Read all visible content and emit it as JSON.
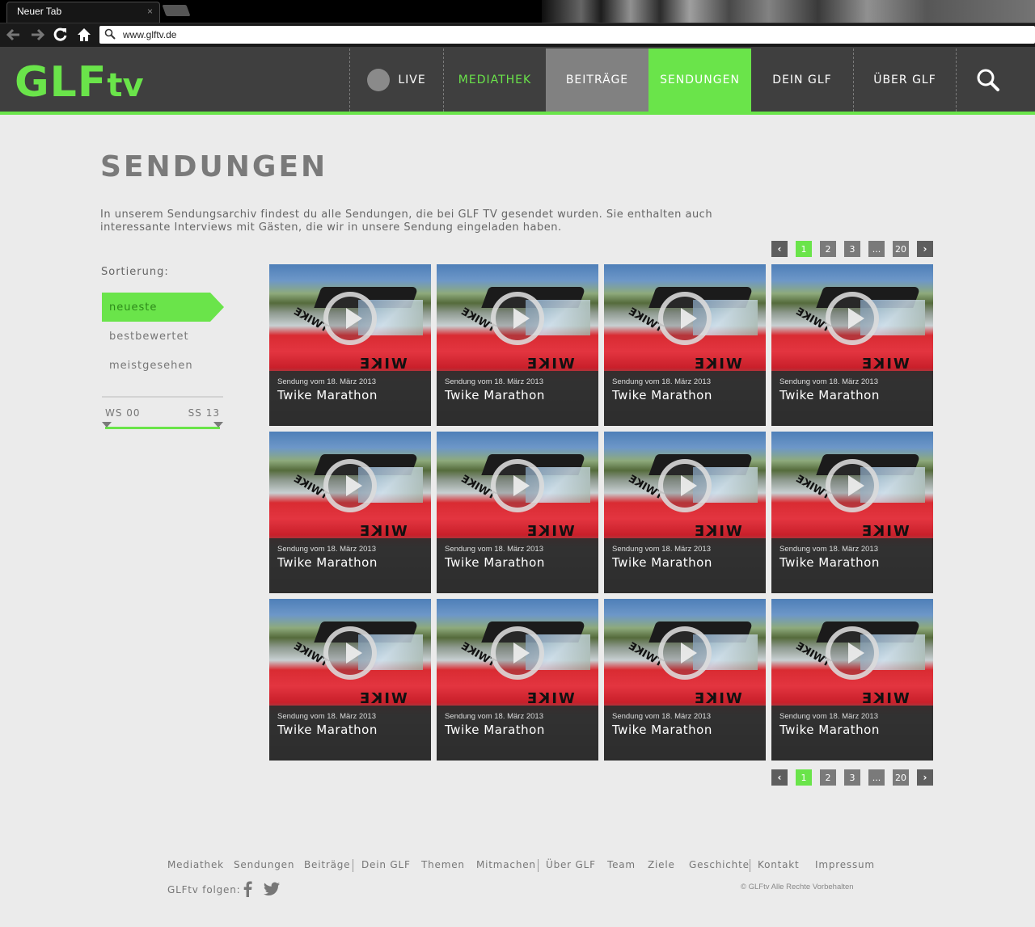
{
  "browser": {
    "tab_title": "Neuer Tab",
    "tab_close": "×",
    "url": "www.glftv.de"
  },
  "header": {
    "logo_main": "GLF",
    "logo_suffix": "tv",
    "nav": [
      {
        "label": "LIVE"
      },
      {
        "label": "MEDIATHEK"
      },
      {
        "label": "BEITRÄGE"
      },
      {
        "label": "SENDUNGEN"
      },
      {
        "label": "DEIN GLF"
      },
      {
        "label": "ÜBER GLF"
      }
    ]
  },
  "page": {
    "title": "SENDUNGEN",
    "intro": "In unserem Sendungsarchiv findest du alle Sendungen, die bei GLF TV gesendet wurden. Sie enthalten auch interessante Interviews mit Gästen, die wir in unsere Sendung eingeladen haben."
  },
  "pagination": {
    "prev": "‹",
    "next": "›",
    "pages": [
      "1",
      "2",
      "3",
      "...",
      "20"
    ],
    "current": "1"
  },
  "sidebar": {
    "sort_label": "Sortierung:",
    "sort_options": [
      "neueste",
      "bestbewertet",
      "meistgesehen"
    ],
    "active_sort": "neueste",
    "range_start": "WS 00",
    "range_end": "SS 13"
  },
  "cards": [
    {
      "date": "Sendung vom 18. März 2013",
      "title": "Twike Marathon"
    },
    {
      "date": "Sendung vom 18. März 2013",
      "title": "Twike Marathon"
    },
    {
      "date": "Sendung vom 18. März 2013",
      "title": "Twike Marathon"
    },
    {
      "date": "Sendung vom 18. März 2013",
      "title": "Twike Marathon"
    },
    {
      "date": "Sendung vom 18. März 2013",
      "title": "Twike Marathon"
    },
    {
      "date": "Sendung vom 18. März 2013",
      "title": "Twike Marathon"
    },
    {
      "date": "Sendung vom 18. März 2013",
      "title": "Twike Marathon"
    },
    {
      "date": "Sendung vom 18. März 2013",
      "title": "Twike Marathon"
    },
    {
      "date": "Sendung vom 18. März 2013",
      "title": "Twike Marathon"
    },
    {
      "date": "Sendung vom 18. März 2013",
      "title": "Twike Marathon"
    },
    {
      "date": "Sendung vom 18. März 2013",
      "title": "Twike Marathon"
    },
    {
      "date": "Sendung vom 18. März 2013",
      "title": "Twike Marathon"
    }
  ],
  "card_image_text": {
    "brand": "WIKE",
    "brand_side": "TWIKE"
  },
  "footer": {
    "links": [
      "Mediathek",
      "Sendungen",
      "Beiträge",
      "Dein GLF",
      "Themen",
      "Mitmachen",
      "Über GLF",
      "Team",
      "Ziele",
      "Geschichte",
      "Kontakt",
      "Impressum"
    ],
    "follow_label": "GLFtv folgen:",
    "copyright": "© GLFtv Alle Rechte Vorbehalten"
  },
  "colors": {
    "accent": "#6ae44a",
    "header_bg": "#3f3f3f",
    "page_bg": "#ebebeb",
    "active_tab_bg": "#818181"
  },
  "icons": {
    "back": "arrow-left-icon",
    "forward": "arrow-right-icon",
    "reload": "reload-icon",
    "home": "home-icon",
    "search": "search-icon",
    "facebook": "facebook-icon",
    "twitter": "twitter-icon",
    "play": "play-icon"
  }
}
